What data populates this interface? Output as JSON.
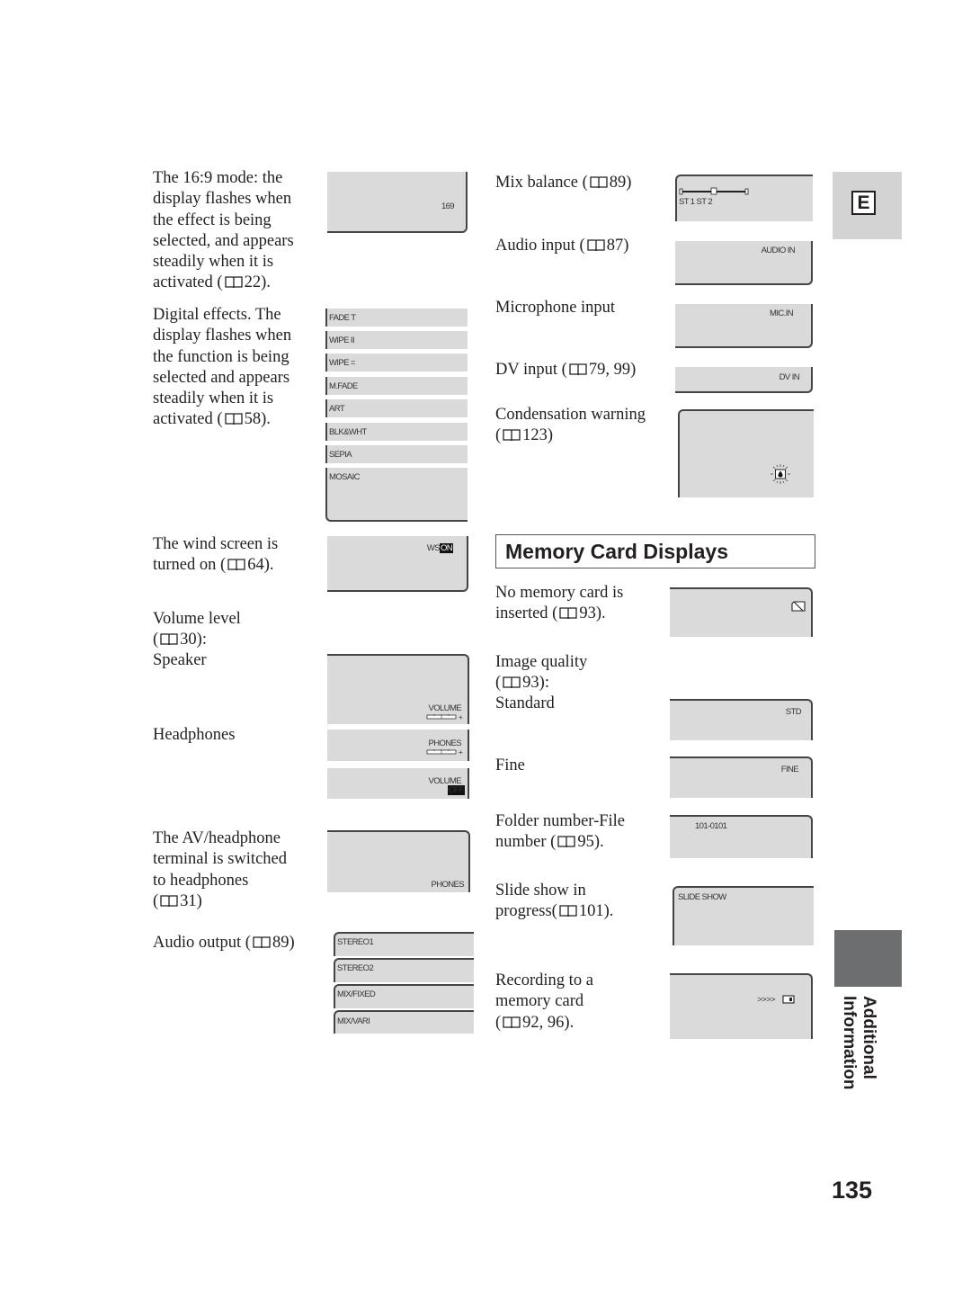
{
  "left_column": {
    "mode169": {
      "text": "The 16:9 mode: the\ndisplay flashes when\nthe effect is being\nselected, and appears\nsteadily when it is\nactivated (",
      "ref": "22).",
      "display": "169"
    },
    "digital_effects": {
      "text": "Digital effects. The\ndisplay flashes when\nthe function is being\nselected and appears\nsteadily when it is\nactivated (",
      "ref": "58).",
      "displays": [
        "FADE T",
        "WIPE  II",
        "WIPE  =",
        "M.FADE",
        "ART",
        "BLK&WHT",
        "SEPIA",
        "MOSAIC"
      ]
    },
    "wind_screen": {
      "text": "The wind screen is\nturned on (",
      "ref": "64).",
      "display_prefix": "WS",
      "display_inv": "ON"
    },
    "volume_level": {
      "text": "Volume level\n(",
      "ref": "30):",
      "speaker_label": "Speaker",
      "headphones_label": "Headphones",
      "speaker_display": "VOLUME",
      "phones_display": "PHONES",
      "off_display": "VOLUME",
      "off_inv": "OFF",
      "plus": "+"
    },
    "av_headphone": {
      "text": "The AV/headphone\nterminal is switched\nto headphones\n(",
      "ref": "31)",
      "display": "PHONES"
    },
    "audio_output": {
      "text": "Audio output (",
      "ref": "89)",
      "displays": [
        "STEREO1",
        "STEREO2",
        "MIX/FIXED",
        "MIX/VARI"
      ]
    }
  },
  "right_column": {
    "mix_balance": {
      "text": "Mix balance (",
      "ref": "89)",
      "display": "ST 1  ST 2"
    },
    "audio_input": {
      "text": "Audio input (",
      "ref": "87)",
      "display": "AUDIO IN"
    },
    "mic_input": {
      "text": "Microphone input",
      "display": "MIC.IN"
    },
    "dv_input": {
      "text": "DV input (",
      "ref": "79, 99)",
      "display": "DV IN"
    },
    "condensation": {
      "text": "Condensation warning\n(",
      "ref": "123)",
      "icon": "condensation-warning-icon"
    },
    "memory_card": {
      "heading": "Memory Card Displays",
      "no_card": {
        "text": "No memory card is\ninserted (",
        "ref": "93).",
        "icon": "no-card-icon"
      },
      "image_quality": {
        "text": "Image quality\n(",
        "ref": "93):",
        "standard_label": "Standard",
        "fine_label": "Fine",
        "std_display": "STD",
        "fine_display": "FINE"
      },
      "folder_file": {
        "text": "Folder number-File\nnumber (",
        "ref": "95).",
        "display": "101-0101"
      },
      "slide_show": {
        "text": "Slide show in\nprogress(",
        "ref": "101).",
        "display": "SLIDE SHOW"
      },
      "recording": {
        "text": "Recording to a\nmemory card\n(",
        "ref": "92, 96).",
        "display": ">>>>"
      }
    }
  },
  "sidebar": {
    "language_tab": "E",
    "section_label_1": "Additional",
    "section_label_2": "Information"
  },
  "page_number": "135"
}
